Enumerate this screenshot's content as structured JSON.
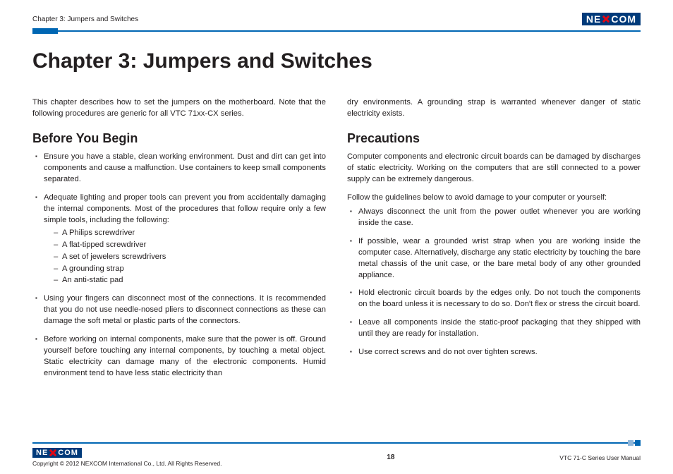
{
  "header": {
    "breadcrumb": "Chapter 3: Jumpers and Switches",
    "logo_left": "NE",
    "logo_right": "COM"
  },
  "title": "Chapter 3: Jumpers and Switches",
  "intro": "This chapter describes how to set the jumpers on the motherboard. Note that the following procedures are generic for all VTC 71xx-CX series.",
  "before": {
    "heading": "Before You Begin",
    "b1": "Ensure you have a stable, clean working environment. Dust and dirt can get into components and cause a malfunction. Use containers to keep small components separated.",
    "b2": "Adequate lighting and proper tools can prevent you from accidentally damaging the internal components. Most of the procedures that follow require only a few simple tools, including the following:",
    "tools": {
      "t1": "A Philips screwdriver",
      "t2": "A flat-tipped screwdriver",
      "t3": "A set of jewelers screwdrivers",
      "t4": "A grounding strap",
      "t5": "An anti-static pad"
    },
    "b3": "Using your fingers can disconnect most of the connections. It is recommended that you do not use needle-nosed pliers to disconnect connections as these can damage the soft metal or plastic parts of the connectors.",
    "b4": "Before working on internal components, make sure that the power is off. Ground yourself before touching any internal components, by touching a metal object. Static electricity can damage many of the electronic components. Humid environment tend to have less static electricity than"
  },
  "carryover": "dry environments. A grounding strap is warranted whenever danger of static electricity exists.",
  "precautions": {
    "heading": "Precautions",
    "p_intro": "Computer components and electronic circuit boards can be damaged by discharges of static electricity. Working on the computers that are still connected to a power supply can be extremely dangerous.",
    "p_lead": "Follow the guidelines below to avoid damage to your computer or yourself:",
    "g1": "Always disconnect the unit from the power outlet whenever you are working inside the case.",
    "g2": "If possible, wear a grounded wrist strap when you are working inside the computer case. Alternatively, discharge any static electricity by touching the bare metal chassis of the unit case, or the bare metal body of any other grounded appliance.",
    "g3": "Hold electronic circuit boards by the edges only. Do not touch the components on the board unless it is necessary to do so. Don't flex or stress the circuit board.",
    "g4": "Leave all components inside the static-proof packaging that they shipped with until they are ready for installation.",
    "g5": "Use correct screws and do not over tighten screws."
  },
  "footer": {
    "copyright": "Copyright © 2012 NEXCOM International Co., Ltd. All Rights Reserved.",
    "page": "18",
    "doc": "VTC 71-C Series User Manual"
  }
}
